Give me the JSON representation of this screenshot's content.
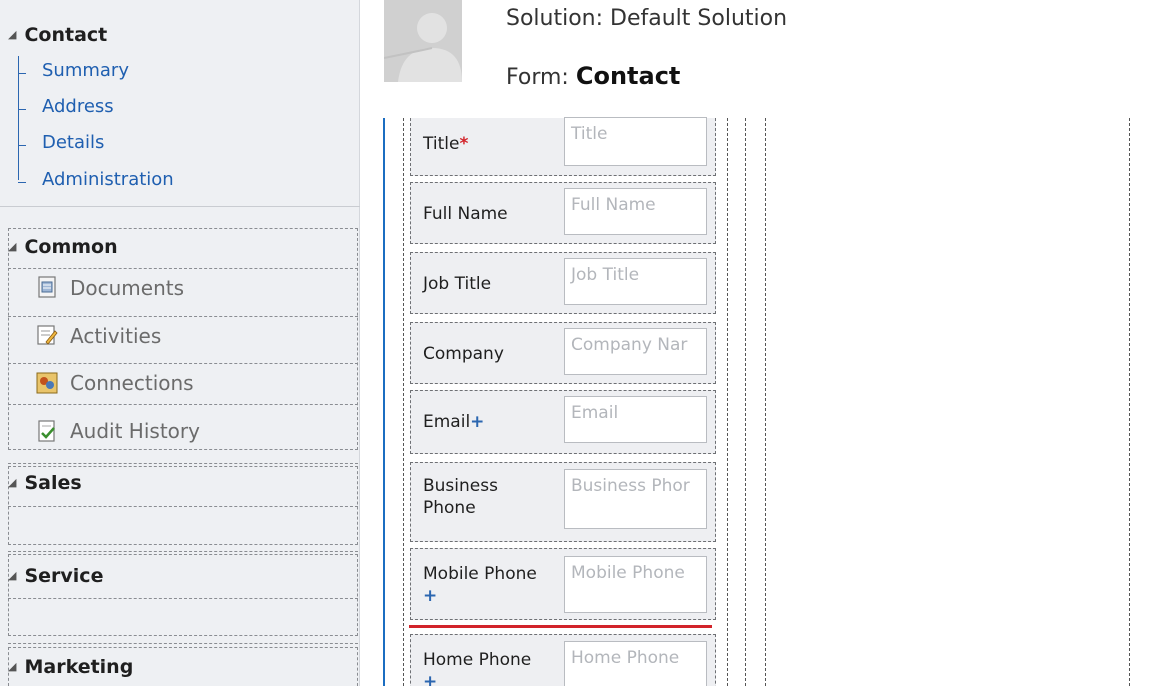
{
  "sidebar": {
    "contact": {
      "title": "Contact",
      "items": [
        "Summary",
        "Address",
        "Details",
        "Administration"
      ]
    },
    "common": {
      "title": "Common",
      "items": [
        {
          "label": "Documents",
          "icon": "documents-icon"
        },
        {
          "label": "Activities",
          "icon": "activities-icon"
        },
        {
          "label": "Connections",
          "icon": "connections-icon"
        },
        {
          "label": "Audit History",
          "icon": "audit-history-icon"
        }
      ]
    },
    "sales": {
      "title": "Sales"
    },
    "service": {
      "title": "Service"
    },
    "marketing": {
      "title": "Marketing"
    }
  },
  "header": {
    "solution_label": "Solution: Default Solution",
    "form_prefix": "Form:",
    "form_name": "Contact"
  },
  "fields": [
    {
      "label": "Title",
      "marker": "*",
      "placeholder": "Title"
    },
    {
      "label": "Full Name",
      "marker": "",
      "placeholder": "Full Name"
    },
    {
      "label": "Job Title",
      "marker": "",
      "placeholder": "Job Title"
    },
    {
      "label": "Company",
      "marker": "",
      "placeholder": "Company Nar"
    },
    {
      "label": "Email",
      "marker": "+",
      "placeholder": "Email"
    },
    {
      "label_line1": "Business",
      "label_line2": "Phone",
      "placeholder": "Business Phor"
    },
    {
      "label": "Mobile Phone",
      "marker": "+",
      "placeholder": "Mobile Phone"
    },
    {
      "label": "Home Phone",
      "marker": "+",
      "placeholder": "Home Phone"
    }
  ],
  "colors": {
    "required": "#d2232a",
    "recommended": "#2b66b0",
    "accent": "#1b6dc1",
    "insert_marker": "#d2232a"
  }
}
